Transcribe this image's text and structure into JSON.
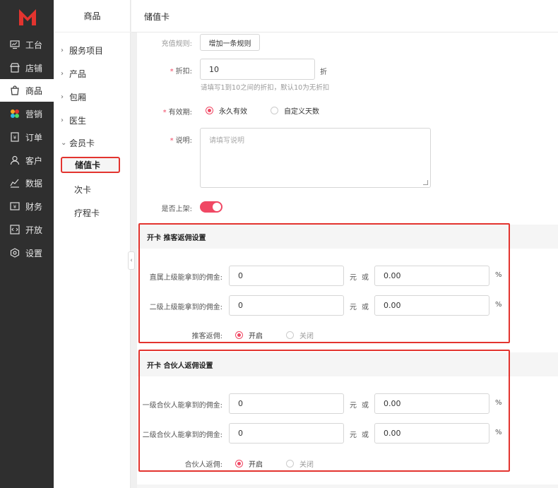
{
  "sidebar": {
    "items": [
      {
        "label": "工台",
        "icon": "monitor-icon"
      },
      {
        "label": "店铺",
        "icon": "store-icon"
      },
      {
        "label": "商品",
        "icon": "shopping-bag-icon"
      },
      {
        "label": "营销",
        "icon": "marketing-icon"
      },
      {
        "label": "订单",
        "icon": "order-icon"
      },
      {
        "label": "客户",
        "icon": "user-icon"
      },
      {
        "label": "数据",
        "icon": "chart-icon"
      },
      {
        "label": "财务",
        "icon": "finance-icon"
      },
      {
        "label": "开放",
        "icon": "code-icon"
      },
      {
        "label": "设置",
        "icon": "settings-icon"
      }
    ],
    "accent": "#e3342f"
  },
  "subside": {
    "title": "商品",
    "groups": [
      {
        "label": "服务项目"
      },
      {
        "label": "产品"
      },
      {
        "label": "包厢"
      },
      {
        "label": "医生"
      },
      {
        "label": "会员卡"
      }
    ],
    "children": [
      {
        "label": "储值卡"
      },
      {
        "label": "次卡"
      },
      {
        "label": "疗程卡"
      }
    ]
  },
  "header": {
    "title": "储值卡"
  },
  "form": {
    "rule_label": "充值规则:",
    "add_rule_button": "增加一条规则",
    "discount_label": "折扣:",
    "discount_value": "10",
    "discount_unit": "折",
    "discount_hint": "请填写1到10之间的折扣，默认10为无折扣",
    "validity_label": "有效期:",
    "validity_options": [
      "永久有效",
      "自定义天数"
    ],
    "desc_label": "说明:",
    "desc_placeholder": "请填写说明",
    "listed_label": "是否上架:"
  },
  "recommend": {
    "title": "开卡 推客返佣设置",
    "row1_label": "直属上级能拿到的佣金:",
    "row1_value": "0",
    "row1_unit": "元",
    "row1_or": "或",
    "row1_percent": "0.00",
    "row1_pct_sign": "%",
    "row2_label": "二级上级能拿到的佣金:",
    "row2_value": "0",
    "row2_unit": "元",
    "row2_or": "或",
    "row2_percent": "0.00",
    "row2_pct_sign": "%",
    "switch_label": "推客返佣:",
    "on": "开启",
    "off": "关闭"
  },
  "partner": {
    "title": "开卡 合伙人返佣设置",
    "row1_label": "一级合伙人能拿到的佣金:",
    "row1_value": "0",
    "row1_unit": "元",
    "row1_or": "或",
    "row1_percent": "0.00",
    "row1_pct_sign": "%",
    "row2_label": "二级合伙人能拿到的佣金:",
    "row2_value": "0",
    "row2_unit": "元",
    "row2_or": "或",
    "row2_percent": "0.00",
    "row2_pct_sign": "%",
    "switch_label": "合伙人返佣:",
    "on": "开启",
    "off": "关闭"
  }
}
